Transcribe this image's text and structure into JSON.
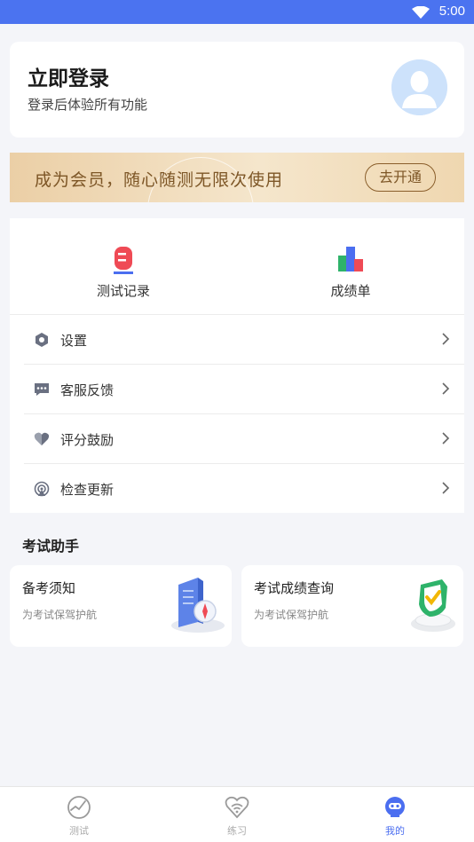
{
  "status_bar": {
    "time": "5:00"
  },
  "login": {
    "title": "立即登录",
    "subtitle": "登录后体验所有功能"
  },
  "vip": {
    "text": "成为会员，随心随测无限次使用",
    "button": "去开通"
  },
  "quick": [
    {
      "label": "测试记录",
      "icon": "clipboard-record-icon"
    },
    {
      "label": "成绩单",
      "icon": "bar-chart-icon"
    }
  ],
  "menu": [
    {
      "label": "设置",
      "icon": "hexagon-gear-icon"
    },
    {
      "label": "客服反馈",
      "icon": "chat-bubble-icon"
    },
    {
      "label": "评分鼓励",
      "icon": "heart-icon"
    },
    {
      "label": "检查更新",
      "icon": "signal-update-icon"
    }
  ],
  "assistant": {
    "title": "考试助手",
    "cards": [
      {
        "title": "备考须知",
        "subtitle": "为考试保驾护航"
      },
      {
        "title": "考试成绩查询",
        "subtitle": "为考试保驾护航"
      }
    ]
  },
  "tabs": [
    {
      "label": "测试",
      "active": false
    },
    {
      "label": "练习",
      "active": false
    },
    {
      "label": "我的",
      "active": true
    }
  ],
  "colors": {
    "accent": "#4b73f0",
    "vip_text": "#7d5626",
    "tab_active": "#4b6ef0"
  }
}
